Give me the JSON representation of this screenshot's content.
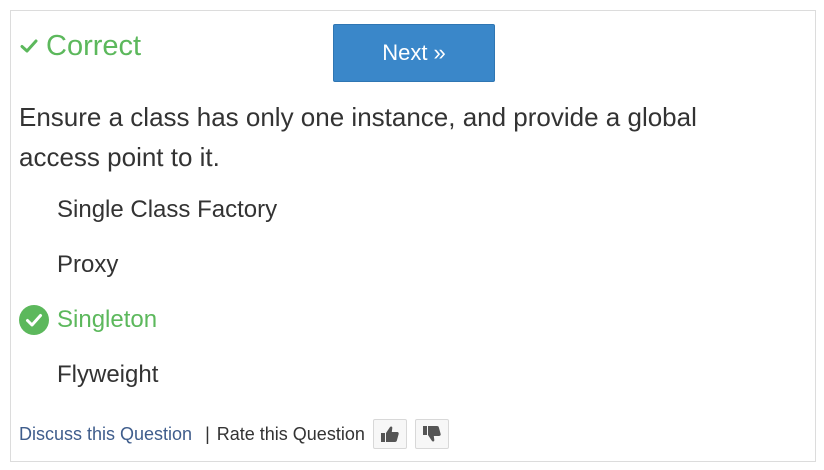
{
  "result": {
    "label": "Correct",
    "icon": "check-icon",
    "color": "#5cb85c"
  },
  "next_button": {
    "label": "Next »",
    "color": "#3a87c9"
  },
  "question": {
    "text": "Ensure a class has only one instance, and provide a global access point to it."
  },
  "options": [
    {
      "label": "Single Class Factory",
      "correct": false
    },
    {
      "label": "Proxy",
      "correct": false
    },
    {
      "label": "Singleton",
      "correct": true,
      "icon": "check-circle-icon"
    },
    {
      "label": "Flyweight",
      "correct": false
    }
  ],
  "footer": {
    "discuss_label": "Discuss this Question",
    "separator": "|",
    "rate_label": "Rate this Question",
    "thumbs_up_icon": "thumbs-up-icon",
    "thumbs_down_icon": "thumbs-down-icon"
  }
}
